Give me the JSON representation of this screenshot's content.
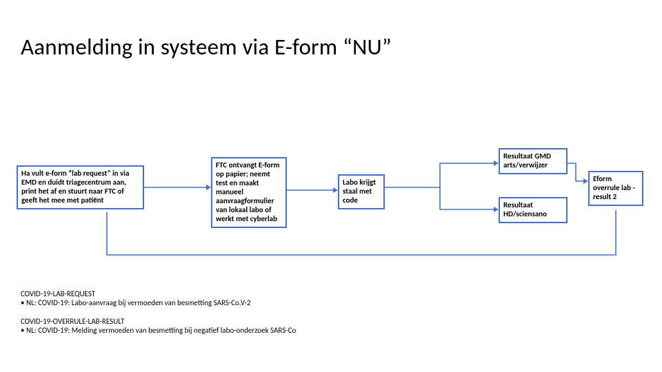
{
  "title": "Aanmelding in systeem via E-form “NU”",
  "boxes": {
    "b1": "Ha vult e-form “lab request” in via EMD en duidt triagecentrum aan, print het af en stuurt naar FTC of geeft het mee met patiënt",
    "b2": "FTC ontvangt E-form op papier; neemt test en maakt manueel aanvraagformulier van lokaal labo of werkt met cyberlab",
    "b3": "Labo krijgt staal met code",
    "b4": "Resultaat GMD arts/verwijzer",
    "b5": "Resultaat HD/sciensano",
    "b6": "Eform overrule lab -result 2"
  },
  "notes": {
    "n1_hdr": "COVID-19-LAB-REQUEST",
    "n1_it": "• NL: COVID-19: Labo-aanvraag bij vermoeden van besmetting SARS-Co.V-2",
    "n2_hdr": "COVID-19-OVERRULE-LAB-RESULT",
    "n2_it": "• NL: COVID-19: Melding vermoeden van besmetting bij negatief labo-onderzoek SARS-Co"
  }
}
